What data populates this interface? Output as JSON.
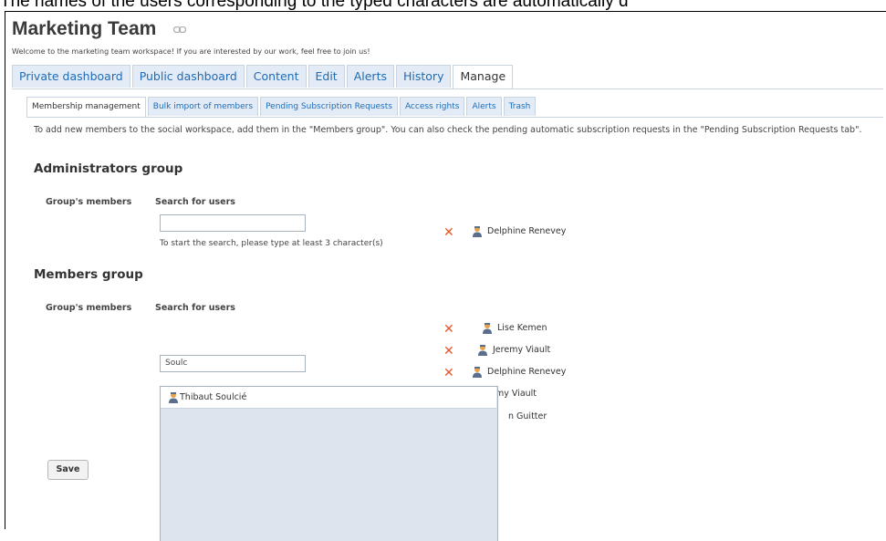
{
  "caption": "The names of the users corresponding to the typed characters are automatically d",
  "workspace": {
    "title": "Marketing Team",
    "welcome": "Welcome to the marketing team workspace! If you are interested by our work, feel free to join us!"
  },
  "main_tabs": [
    {
      "label": "Private dashboard"
    },
    {
      "label": "Public dashboard"
    },
    {
      "label": "Content"
    },
    {
      "label": "Edit"
    },
    {
      "label": "Alerts"
    },
    {
      "label": "History"
    },
    {
      "label": "Manage",
      "active": true
    }
  ],
  "sub_tabs": [
    {
      "label": "Membership management",
      "active": true
    },
    {
      "label": "Bulk import of members"
    },
    {
      "label": "Pending Subscription Requests"
    },
    {
      "label": "Access rights"
    },
    {
      "label": "Alerts"
    },
    {
      "label": "Trash"
    }
  ],
  "info_text": "To add new members to the social workspace, add them in the \"Members group\". You can also check the pending automatic subscription requests in the \"Pending Subscription Requests tab\".",
  "admins": {
    "title": "Administrators group",
    "members_label": "Group's members",
    "search_label": "Search for users",
    "search_value": "",
    "hint": "To start the search, please type at least 3 character(s)",
    "members": [
      "Delphine Renevey"
    ]
  },
  "members_group": {
    "title": "Members group",
    "members_label": "Group's members",
    "search_label": "Search for users",
    "search_value": "Soulc",
    "members": [
      "Lise Kemen",
      "Jeremy Viault",
      "Delphine Renevey",
      "my Viault",
      "n Guitter"
    ]
  },
  "autocomplete": {
    "suggestion": "Thibaut Soulcié"
  },
  "save_label": "Save",
  "colors": {
    "link": "#1f6bb5",
    "remove": "#e05a2b",
    "tab_bg": "#e3ecf6",
    "dropdown_bg": "#dce4ee"
  }
}
